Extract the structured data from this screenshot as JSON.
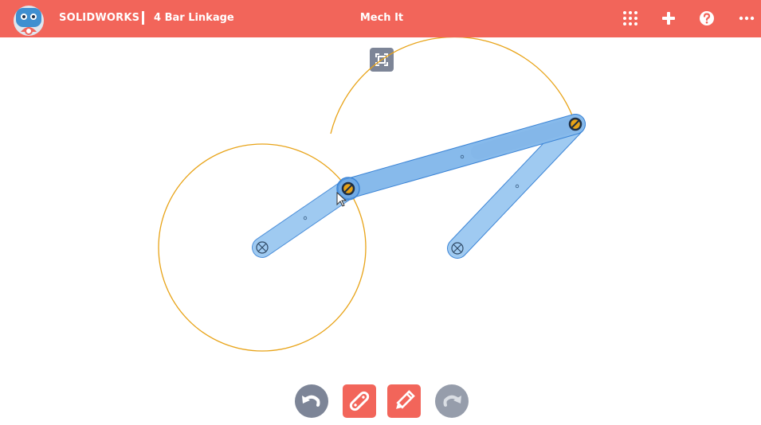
{
  "header": {
    "brand": "SOLIDWORKS",
    "document_title": "4 Bar Linkage",
    "app_title": "Mech It",
    "background_color": "#f2655a",
    "icons": [
      "apps-grid-icon",
      "plus-icon",
      "help-icon",
      "more-horizontal-icon"
    ]
  },
  "toolbar": {
    "fit_view_icon": "fit-to-screen-icon"
  },
  "bottom_toolbar": {
    "buttons": [
      {
        "name": "undo",
        "icon": "undo-icon",
        "color": "#7d8597"
      },
      {
        "name": "link-tool",
        "icon": "link-icon",
        "color": "#f2655a"
      },
      {
        "name": "draw-tool",
        "icon": "pencil-icon",
        "color": "#f2655a"
      },
      {
        "name": "redo",
        "icon": "redo-icon",
        "color": "#7d8597"
      }
    ]
  },
  "canvas": {
    "link_fill_color": "#90c2ee",
    "link_stroke_color": "#3b84d6",
    "path_color": "#e8a317",
    "fixed_pivots": 2,
    "moving_joints": 2,
    "links": 3
  }
}
